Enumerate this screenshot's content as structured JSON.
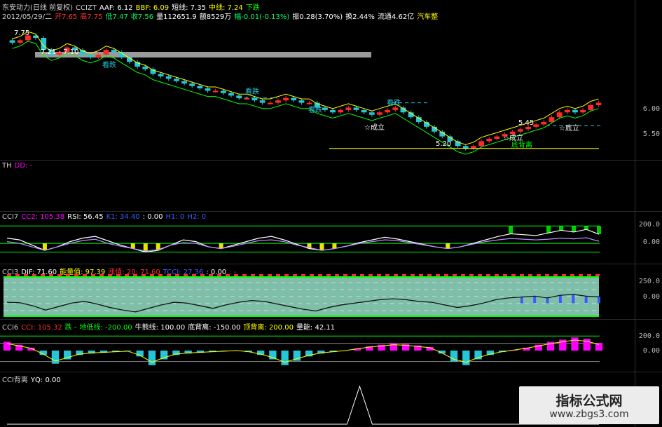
{
  "colors": {
    "up": "#ff2a2a",
    "down": "#26c6da",
    "yellow": "#ffff00",
    "green": "#00ff00",
    "magenta": "#ff00ff",
    "white": "#ffffff",
    "blue": "#3a5cff",
    "teal_fill": "#7fbfa9",
    "grey_band": "#9a9a9a"
  },
  "main": {
    "header": [
      {
        "text": "东安动力(日线 前复权)",
        "color": "#cfcfcf"
      },
      {
        "text": "CCIZT",
        "color": "#cfcfcf"
      },
      {
        "text": "AAF: 6.12",
        "color": "#ffffff"
      },
      {
        "text": "BBF: 6.09",
        "color": "#ffff00"
      },
      {
        "text": "短线: 7.35",
        "color": "#ffffff"
      },
      {
        "text": "中线: 7.24",
        "color": "#ffff00"
      },
      {
        "text": "下跌",
        "color": "#00ff00"
      }
    ],
    "quote": [
      {
        "text": "2012/05/29/二",
        "color": "#cfcfcf"
      },
      {
        "text": "开7.65",
        "color": "#ff3030"
      },
      {
        "text": "高7.75",
        "color": "#ff3030"
      },
      {
        "text": "低7.47",
        "color": "#00ff66"
      },
      {
        "text": "收7.56",
        "color": "#00ff66"
      },
      {
        "text": "量112651.9",
        "color": "#ffffff"
      },
      {
        "text": "额8529万",
        "color": "#ffffff"
      },
      {
        "text": "幅-0.01(-0.13%)",
        "color": "#00ff66"
      },
      {
        "text": "振0.28(3.70%)",
        "color": "#ffffff"
      },
      {
        "text": "换2.44%",
        "color": "#ffffff"
      },
      {
        "text": "流通4.62亿",
        "color": "#ffffff"
      },
      {
        "text": "汽车整",
        "color": "#ffff00"
      }
    ],
    "labels": {
      "high": "7.75",
      "range": "7.21 - 7.10",
      "low": "5.20",
      "kandie": "看跌",
      "chengli": "☆成立",
      "dibei": "底背离",
      "dicheng": "☆底立",
      "small": "5.45"
    },
    "ticks": [
      "6.00",
      "5.50"
    ]
  },
  "th": {
    "header": [
      {
        "text": "TH",
        "color": "#cfcfcf"
      },
      {
        "text": "DD: -",
        "color": "#ff00ff"
      }
    ]
  },
  "cci7": {
    "header": [
      {
        "text": "CCI7",
        "color": "#cfcfcf"
      },
      {
        "text": "CC2: 105.38",
        "color": "#ff00ff"
      },
      {
        "text": "RSI: 56.45",
        "color": "#ffffff"
      },
      {
        "text": "K1: 34.40",
        "color": "#3a5cff"
      },
      {
        "text": ": 0.00",
        "color": "#ffffff"
      },
      {
        "text": "H1: 0",
        "color": "#3a5cff"
      },
      {
        "text": "H2: 0",
        "color": "#3a5cff"
      }
    ],
    "ticks": [
      "200.0",
      "0.00"
    ]
  },
  "cci3": {
    "header": [
      {
        "text": "CCI3",
        "color": "#cfcfcf"
      },
      {
        "text": "DIF: 71.60",
        "color": "#ffffff"
      },
      {
        "text": "能量值: 97.39",
        "color": "#ffff00"
      },
      {
        "text": "涨值: 20: 71.60",
        "color": "#ff3030"
      },
      {
        "text": "TCCI: 27.36",
        "color": "#3a5cff"
      },
      {
        "text": ": 0.00",
        "color": "#ffffff"
      },
      {
        "text": ": -",
        "color": "#ff00ff"
      }
    ],
    "ticks": [
      "250.0",
      "0.00"
    ]
  },
  "cci6": {
    "header": [
      {
        "text": "CCI6",
        "color": "#cfcfcf"
      },
      {
        "text": "CCI: 105.32",
        "color": "#ff3030"
      },
      {
        "text": "跌 -",
        "color": "#00ff00"
      },
      {
        "text": "地低线: -200.00",
        "color": "#00ff00"
      },
      {
        "text": "牛熊线: 100.00",
        "color": "#ffffff"
      },
      {
        "text": "底背离: -150.00",
        "color": "#ffffff"
      },
      {
        "text": "顶背离: 200.00",
        "color": "#ffff00"
      },
      {
        "text": "量能: 42.11",
        "color": "#ffffff"
      }
    ],
    "ticks": [
      "200.0",
      "0.00"
    ]
  },
  "yq": {
    "header": [
      {
        "text": "CCI背离",
        "color": "#cfcfcf"
      },
      {
        "text": "YQ: 0.00",
        "color": "#ffffff"
      }
    ]
  },
  "watermark": {
    "title": "指标公式网",
    "url": "www.zbgs3.com"
  },
  "chart_data": [
    {
      "type": "candlestick",
      "title": "东安动力(日线 前复权)",
      "close": [
        7.45,
        7.5,
        7.6,
        7.55,
        7.3,
        7.2,
        7.25,
        7.35,
        7.3,
        7.2,
        7.15,
        7.2,
        7.3,
        7.25,
        7.15,
        7.05,
        6.95,
        6.9,
        6.8,
        6.75,
        6.7,
        6.65,
        6.6,
        6.55,
        6.5,
        6.45,
        6.45,
        6.4,
        6.35,
        6.3,
        6.3,
        6.25,
        6.2,
        6.2,
        6.25,
        6.3,
        6.25,
        6.2,
        6.2,
        6.1,
        6.05,
        6.0,
        6.05,
        6.1,
        6.05,
        6.0,
        5.95,
        6.0,
        6.05,
        6.1,
        6.0,
        5.9,
        5.8,
        5.7,
        5.6,
        5.5,
        5.4,
        5.3,
        5.25,
        5.3,
        5.4,
        5.45,
        5.5,
        5.55,
        5.6,
        5.65,
        5.7,
        5.75,
        5.8,
        5.9,
        6.0,
        6.05,
        6.0,
        6.05,
        6.15,
        6.2
      ],
      "ylim": [
        5.1,
        7.9
      ]
    },
    {
      "type": "line",
      "title": "CCI7",
      "series": [
        {
          "name": "CC2",
          "values": [
            60,
            40,
            -20,
            -80,
            -40,
            20,
            60,
            80,
            30,
            -20,
            -60,
            -100,
            -80,
            -20,
            40,
            20,
            -40,
            -60,
            -20,
            20,
            60,
            80,
            40,
            -10,
            -60,
            -80,
            -60,
            -30,
            10,
            40,
            70,
            50,
            20,
            -10,
            -40,
            -60,
            -40,
            0,
            40,
            80,
            110,
            100,
            90,
            120,
            150,
            130,
            160,
            105
          ]
        },
        {
          "name": "RSI",
          "values": [
            55,
            50,
            40,
            30,
            40,
            50,
            58,
            62,
            50,
            42,
            35,
            28,
            32,
            45,
            52,
            50,
            40,
            35,
            42,
            50,
            58,
            60,
            55,
            45,
            38,
            30,
            35,
            42,
            50,
            55,
            60,
            58,
            52,
            46,
            40,
            35,
            40,
            48,
            55,
            60,
            64,
            62,
            60,
            62,
            65,
            63,
            66,
            56
          ]
        }
      ],
      "ylim": [
        -200,
        250
      ]
    },
    {
      "type": "line",
      "title": "CCI3",
      "series": [
        {
          "name": "DIF",
          "values": [
            10,
            5,
            -30,
            -80,
            -40,
            0,
            20,
            -10,
            -50,
            -80,
            -100,
            -60,
            -20,
            10,
            0,
            -30,
            -60,
            -20,
            10,
            30,
            20,
            -10,
            -40,
            -70,
            -90,
            -50,
            -20,
            0,
            20,
            40,
            50,
            40,
            20,
            10,
            -20,
            -50,
            -30,
            0,
            40,
            60,
            70,
            80,
            60,
            90,
            100,
            80,
            71.6
          ]
        }
      ],
      "ylim": [
        -150,
        300
      ]
    },
    {
      "type": "bar",
      "title": "CCI6",
      "series": [
        {
          "name": "CCI",
          "values": [
            120,
            80,
            40,
            -60,
            -180,
            -120,
            -60,
            -40,
            -30,
            -20,
            -10,
            -80,
            -200,
            -120,
            -60,
            -40,
            -30,
            -20,
            -10,
            0,
            -20,
            -60,
            -120,
            -200,
            -140,
            -80,
            -40,
            -20,
            0,
            30,
            60,
            80,
            100,
            90,
            70,
            50,
            -40,
            -150,
            -200,
            -120,
            -60,
            -20,
            10,
            40,
            80,
            120,
            150,
            180,
            160,
            105
          ]
        }
      ],
      "ylim": [
        -250,
        250
      ]
    },
    {
      "type": "line",
      "title": "CCI背离",
      "series": [
        {
          "name": "YQ",
          "values": [
            0,
            0,
            0,
            0,
            0,
            0,
            0,
            0,
            0,
            0,
            0,
            0,
            0,
            0,
            0,
            0,
            0,
            0,
            0,
            0,
            0,
            0,
            0,
            0,
            0,
            0,
            0,
            0,
            1,
            0,
            0,
            0,
            0,
            0,
            0,
            0,
            0,
            0,
            0,
            0,
            0,
            0,
            0,
            0,
            0,
            0,
            0,
            0
          ]
        }
      ],
      "ylim": [
        0,
        1
      ]
    }
  ]
}
